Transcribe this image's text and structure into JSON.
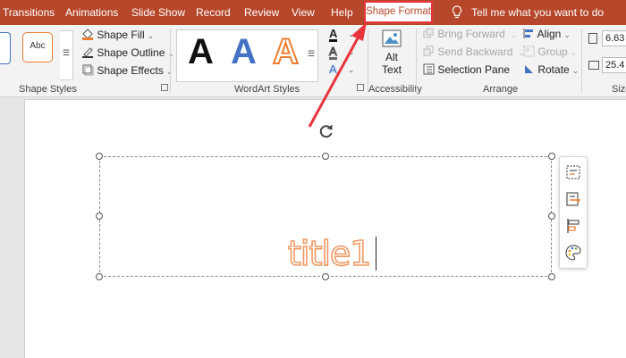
{
  "tabs": [
    {
      "label": "Transitions"
    },
    {
      "label": "Animations"
    },
    {
      "label": "Slide Show"
    },
    {
      "label": "Record"
    },
    {
      "label": "Review"
    },
    {
      "label": "View"
    },
    {
      "label": "Help"
    },
    {
      "label": "Shape Format"
    }
  ],
  "tell_me": "Tell me what you want to do",
  "shape_styles": {
    "preset_label": "Abc",
    "fill": "Shape Fill",
    "outline": "Shape Outline",
    "effects": "Shape Effects",
    "group_label": "Shape Styles"
  },
  "wordart": {
    "sample": "A",
    "group_label": "WordArt Styles",
    "colors": {
      "black": "#111111",
      "blue": "#4472c4",
      "orange": "#ed7d31"
    }
  },
  "accessibility": {
    "alt_text_line1": "Alt",
    "alt_text_line2": "Text",
    "group_label": "Accessibility"
  },
  "arrange": {
    "bring_forward": "Bring Forward",
    "send_backward": "Send Backward",
    "selection_pane": "Selection Pane",
    "align": "Align",
    "group": "Group",
    "rotate": "Rotate",
    "group_label": "Arrange"
  },
  "size": {
    "height": "6.63",
    "width": "25.4",
    "group_label": "Size"
  },
  "slide": {
    "title_text": "title1",
    "title_color": "#f0a57a"
  },
  "colors": {
    "accent_red": "#b7472a",
    "highlight_red": "#e8343c"
  }
}
